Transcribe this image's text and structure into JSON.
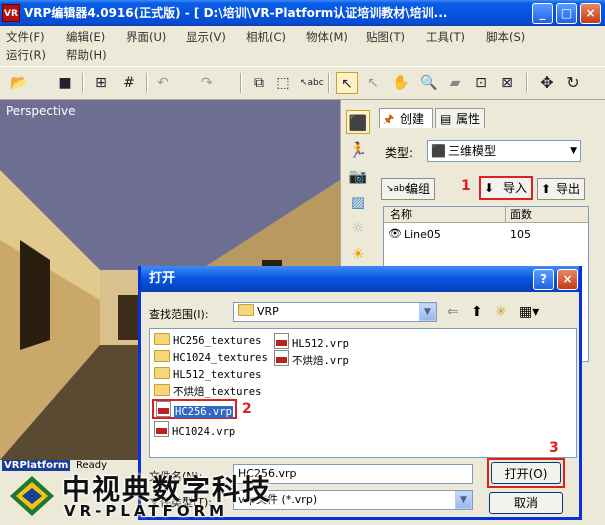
{
  "window": {
    "title": "VRP编辑器4.0916(正式版) - [ D:\\培训\\VR-Platform认证培训教材\\培训...",
    "logo": "VR",
    "controls": [
      "_",
      "□",
      "×"
    ]
  },
  "menu": {
    "row1": [
      "文件(F)",
      "编辑(E)",
      "界面(U)",
      "显示(V)",
      "相机(C)",
      "物体(M)",
      "贴图(T)",
      "工具(T)",
      "脚本(S)"
    ],
    "row2": [
      "运行(R)",
      "帮助(H)"
    ]
  },
  "toolbar": {
    "icons": [
      "open-folder-icon",
      "save-icon",
      "grid-icon",
      "hash-grid-icon",
      "undo-icon",
      "redo-icon",
      "copy-icon",
      "select-region-icon",
      "abc-select-icon",
      "pointer-icon",
      "pointer-move-icon",
      "hand-pan-icon",
      "zoom-icon",
      "eraser-icon",
      "fit-icon",
      "expand-icon",
      "move-icon",
      "rotate-icon"
    ]
  },
  "viewport": {
    "label": "Perspective"
  },
  "right_panel": {
    "tabs": [
      "创建",
      "属性"
    ],
    "type_label": "类型:",
    "type_value": "三维模型",
    "buttons": {
      "group": "编组",
      "import": "导入",
      "export": "导出"
    },
    "table": {
      "headers": [
        "名称",
        "面数"
      ],
      "rows": [
        {
          "name": "Line05",
          "faces": "105"
        }
      ]
    }
  },
  "dialog": {
    "title": "打开",
    "lookin_label": "查找范围(I):",
    "lookin_value": "VRP",
    "files_col1": [
      {
        "name": "HC256_textures",
        "kind": "folder"
      },
      {
        "name": "HC1024_textures",
        "kind": "folder"
      },
      {
        "name": "HL512_textures",
        "kind": "folder"
      },
      {
        "name": "不烘焙_textures",
        "kind": "folder"
      },
      {
        "name": "HC256.vrp",
        "kind": "vrp"
      },
      {
        "name": "HC1024.vrp",
        "kind": "vrp"
      }
    ],
    "files_col2": [
      {
        "name": "HL512.vrp",
        "kind": "vrp"
      },
      {
        "name": "不烘焙.vrp",
        "kind": "vrp"
      }
    ],
    "filename_label": "文件名(N):",
    "filename_value": "HC256.vrp",
    "filetype_label": "文件类型(T):",
    "filetype_value": "vrp文件 (*.vrp)",
    "open_button": "打开(O)",
    "cancel_button": "取消"
  },
  "annotations": {
    "step1": "1",
    "step2": "2",
    "step3": "3"
  },
  "status": {
    "brand": "VRPlatform",
    "text": "Ready"
  },
  "watermark": {
    "title": "中视典数字科技",
    "subtitle": "VR-PLATFORM"
  },
  "colors": {
    "title_blue": "#0554e0",
    "highlight": "#316ac5",
    "annotation_red": "#e02020"
  }
}
